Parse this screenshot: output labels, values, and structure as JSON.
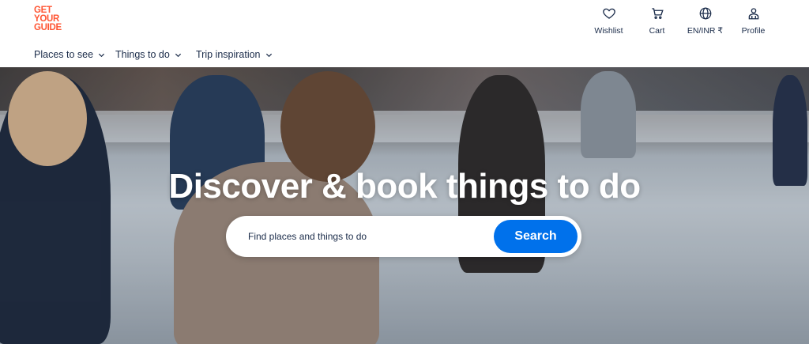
{
  "brand": {
    "logo_lines": [
      "GET",
      "YOUR",
      "GUIDE"
    ],
    "color": "#ff5533"
  },
  "header_actions": [
    {
      "label": "Wishlist",
      "icon": "heart-icon"
    },
    {
      "label": "Cart",
      "icon": "cart-icon"
    },
    {
      "label": "EN/INR ₹",
      "icon": "globe-icon"
    },
    {
      "label": "Profile",
      "icon": "profile-icon"
    }
  ],
  "nav": {
    "items": [
      {
        "label": "Places to see"
      },
      {
        "label": "Things to do"
      },
      {
        "label": "Trip inspiration"
      }
    ]
  },
  "hero": {
    "title": "Discover & book things to do",
    "search_placeholder": "Find places and things to do",
    "search_button": "Search"
  },
  "colors": {
    "text": "#1a2b49",
    "accent": "#0071eb"
  }
}
